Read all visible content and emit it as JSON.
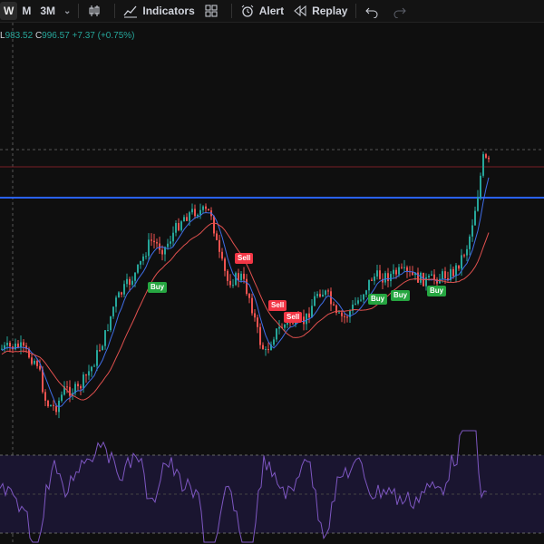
{
  "toolbar": {
    "interval_w": "W",
    "interval_m": "M",
    "interval_3m": "3M",
    "indicators_label": "Indicators",
    "alert_label": "Alert",
    "replay_label": "Replay"
  },
  "price": {
    "low_label": "L",
    "low_value": "983.52",
    "close_label": "C",
    "close_value": "996.57",
    "change": "+7.37 (+0.75%)"
  },
  "colors": {
    "up": "#26a69a",
    "down": "#ef5350",
    "buy": "#26a641",
    "sell": "#f23645",
    "hline": "#2962ff",
    "rsi": "#7e57c2"
  },
  "signals": [
    {
      "type": "Buy",
      "label": "Buy"
    },
    {
      "type": "Sell",
      "label": "Sell"
    },
    {
      "type": "Sell",
      "label": "Sell"
    },
    {
      "type": "Sell",
      "label": "Sell"
    },
    {
      "type": "Buy",
      "label": "Buy"
    },
    {
      "type": "Buy",
      "label": "Buy"
    },
    {
      "type": "Buy",
      "label": "Buy"
    }
  ]
}
